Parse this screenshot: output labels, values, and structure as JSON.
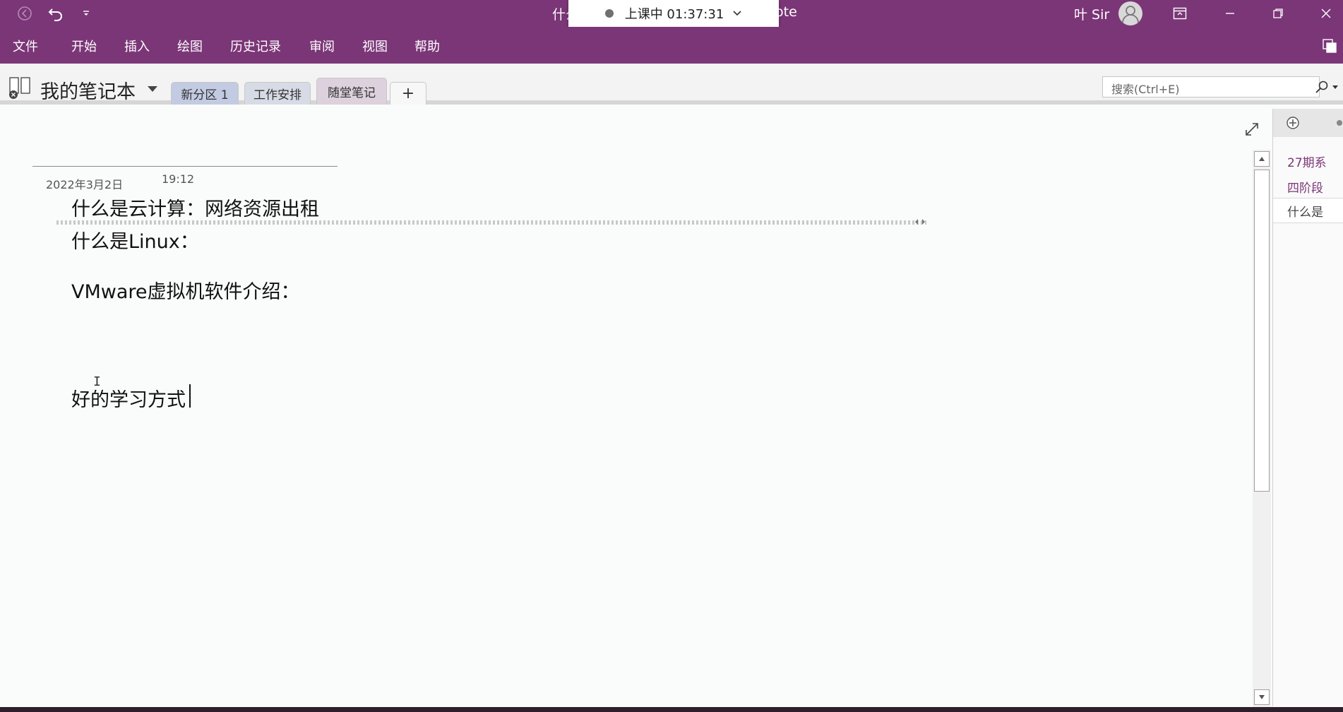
{
  "titlebar": {
    "title_left": "什么",
    "title_right": "ote",
    "recording_status": "上课中 01:37:31",
    "user_name": "叶 Sir"
  },
  "menu": {
    "items": [
      "文件",
      "开始",
      "插入",
      "绘图",
      "历史记录",
      "审阅",
      "视图",
      "帮助"
    ]
  },
  "notebook": {
    "name": "我的笔记本",
    "sections": [
      "新分区 1",
      "工作安排",
      "随堂笔记"
    ],
    "add_section_label": "+",
    "search_placeholder": "搜索(Ctrl+E)"
  },
  "page": {
    "date": "2022年3月2日",
    "time": "19:12",
    "lines": [
      "什么是云计算：网络资源出租",
      "什么是Linux：",
      "VMware虚拟机软件介绍：",
      "好的学习方式"
    ]
  },
  "pages_pane": {
    "items": [
      "27期系",
      "四阶段",
      "什么是"
    ]
  },
  "colors": {
    "brand": "#7b3677",
    "page_bg": "#fafbfb",
    "section_tab_1": "#c3cbe3",
    "section_tab_2": "#d7dbe5",
    "section_tab_3": "#dcd1dc"
  }
}
